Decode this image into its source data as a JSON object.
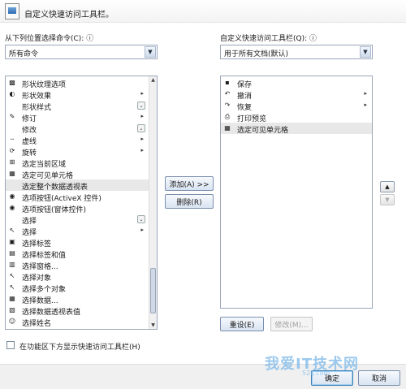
{
  "dialog": {
    "title": "自定义快速访问工具栏。"
  },
  "left": {
    "choose_label": "从下列位置选择命令(C):",
    "choose_value": "所有命令",
    "items": [
      {
        "label": "形状纹理选项",
        "icon": "▩",
        "suffix": ""
      },
      {
        "label": "形状效果",
        "icon": "◐",
        "suffix": "arrow"
      },
      {
        "label": "形状样式",
        "icon": "",
        "suffix": "sub"
      },
      {
        "label": "修订",
        "icon": "✎",
        "suffix": "arrow"
      },
      {
        "label": "修改",
        "icon": "",
        "suffix": "sub"
      },
      {
        "label": "虚线",
        "icon": "┄",
        "suffix": "arrow"
      },
      {
        "label": "旋转",
        "icon": "⟳",
        "suffix": "arrow"
      },
      {
        "label": "选定当前区域",
        "icon": "⊞",
        "suffix": ""
      },
      {
        "label": "选定可见单元格",
        "icon": "▦",
        "suffix": ""
      },
      {
        "label": "选定整个数据透视表",
        "icon": "",
        "suffix": ""
      },
      {
        "label": "选项按钮(ActiveX 控件)",
        "icon": "◉",
        "suffix": ""
      },
      {
        "label": "选项按钮(窗体控件)",
        "icon": "◉",
        "suffix": ""
      },
      {
        "label": "选择",
        "icon": "",
        "suffix": "sub"
      },
      {
        "label": "选择",
        "icon": "↖",
        "suffix": "arrow"
      },
      {
        "label": "选择标签",
        "icon": "▣",
        "suffix": ""
      },
      {
        "label": "选择标签和值",
        "icon": "▤",
        "suffix": ""
      },
      {
        "label": "选择窗格...",
        "icon": "▥",
        "suffix": ""
      },
      {
        "label": "选择对象",
        "icon": "↖",
        "suffix": ""
      },
      {
        "label": "选择多个对象",
        "icon": "↖",
        "suffix": ""
      },
      {
        "label": "选择数据...",
        "icon": "▦",
        "suffix": ""
      },
      {
        "label": "选择数据透视表值",
        "icon": "▧",
        "suffix": ""
      },
      {
        "label": "选择姓名",
        "icon": "☺",
        "suffix": ""
      }
    ],
    "selected_index": 9
  },
  "right": {
    "customize_label": "自定义快速访问工具栏(Q):",
    "customize_value": "用于所有文档(默认)",
    "items": [
      {
        "label": "保存",
        "icon": "▪",
        "suffix": ""
      },
      {
        "label": "撤消",
        "icon": "↶",
        "suffix": "arrow"
      },
      {
        "label": "恢复",
        "icon": "↷",
        "suffix": "arrow"
      },
      {
        "label": "打印预览",
        "icon": "⎙",
        "suffix": ""
      },
      {
        "label": "选定可见单元格",
        "icon": "▦",
        "suffix": ""
      }
    ],
    "selected_index": 4
  },
  "buttons": {
    "add": "添加(A) >>",
    "remove": "删除(R)",
    "reset": "重设(E)",
    "modify": "修改(M)...",
    "ok": "确定",
    "cancel": "取消",
    "move_up": "▲",
    "move_down": "▼"
  },
  "checkbox": {
    "label": "在功能区下方显示快速访问工具栏(H)",
    "checked": false
  },
  "icons": {
    "dropdown": "▼",
    "submenu": "▸",
    "sub_gallery": "⌄",
    "info": "ⓘ"
  },
  "watermark": {
    "text": "我爱IT技术网",
    "sub": "52ij.com"
  }
}
